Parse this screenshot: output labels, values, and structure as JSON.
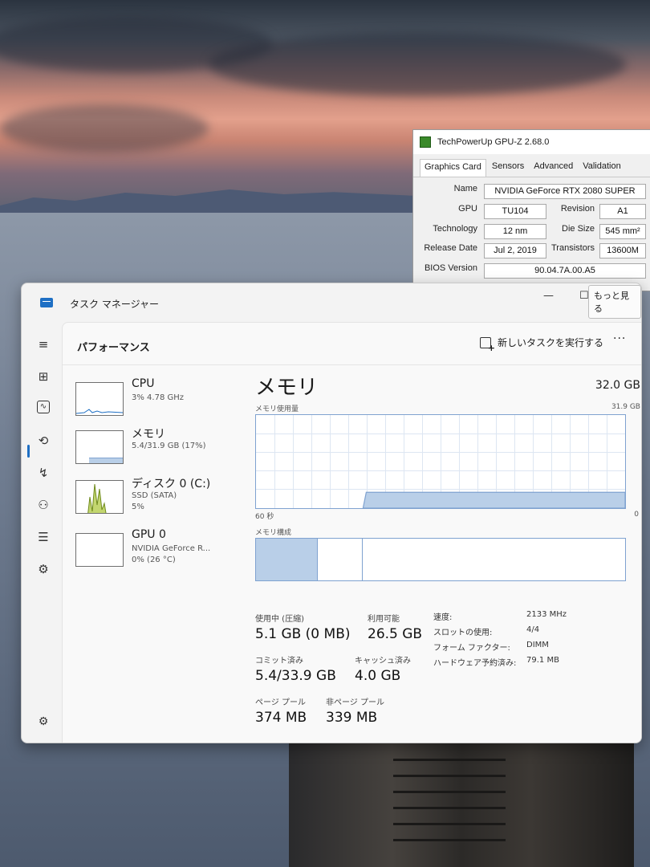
{
  "gpuz": {
    "title": "TechPowerUp GPU-Z 2.68.0",
    "tabs": [
      "Graphics Card",
      "Sensors",
      "Advanced",
      "Validation"
    ],
    "rows": {
      "name_label": "Name",
      "name_value": "NVIDIA GeForce RTX 2080 SUPER",
      "gpu_label": "GPU",
      "gpu_value": "TU104",
      "revision_label": "Revision",
      "revision_value": "A1",
      "technology_label": "Technology",
      "technology_value": "12 nm",
      "die_size_label": "Die Size",
      "die_size_value": "545 mm²",
      "release_label": "Release Date",
      "release_value": "Jul 2, 2019",
      "transistors_label": "Transistors",
      "transistors_value": "13600M",
      "bios_label": "BIOS Version",
      "bios_value": "90.04.7A.00.A5"
    }
  },
  "taskmanager": {
    "title": "タスク マネージャー",
    "tooltip": "もっと見る",
    "page_title": "パフォーマンス",
    "run_task_label": "新しいタスクを実行する",
    "resources": [
      {
        "name": "CPU",
        "line1": "3%  4.78 GHz",
        "line2": ""
      },
      {
        "name": "メモリ",
        "line1": "5.4/31.9 GB (17%)",
        "line2": ""
      },
      {
        "name": "ディスク 0 (C:)",
        "line1": "SSD (SATA)",
        "line2": "5%"
      },
      {
        "name": "GPU 0",
        "line1": "NVIDIA GeForce R...",
        "line2": "0%  (26 °C)"
      }
    ],
    "memory": {
      "heading": "メモリ",
      "total": "32.0 GB",
      "usage_label": "メモリ使用量",
      "usage_max": "31.9 GB",
      "axis_left": "60 秒",
      "axis_right": "0",
      "usage_fraction": 0.17,
      "composition_label": "メモリ構成",
      "stats": {
        "in_use_label": "使用中 (圧縮)",
        "in_use_value": "5.1 GB (0 MB)",
        "available_label": "利用可能",
        "available_value": "26.5 GB",
        "committed_label": "コミット済み",
        "committed_value": "5.4/33.9 GB",
        "cached_label": "キャッシュ済み",
        "cached_value": "4.0 GB",
        "paged_label": "ページ プール",
        "paged_value": "374 MB",
        "nonpaged_label": "非ページ プール",
        "nonpaged_value": "339 MB"
      },
      "details": {
        "speed_label": "速度:",
        "speed_value": "2133 MHz",
        "slots_label": "スロットの使用:",
        "slots_value": "4/4",
        "form_label": "フォーム ファクター:",
        "form_value": "DIMM",
        "reserved_label": "ハードウェア予約済み:",
        "reserved_value": "79.1 MB"
      }
    },
    "nav_icons": [
      "menu-icon",
      "processes-icon",
      "performance-icon",
      "app-history-icon",
      "startup-icon",
      "users-icon",
      "details-icon",
      "services-icon",
      "settings-icon"
    ],
    "colors": {
      "accent": "#1e6fc4",
      "memory_fill": "#b9cfe8",
      "memory_line": "#7fa2d0",
      "disk_fill": "#c3d66f"
    }
  }
}
